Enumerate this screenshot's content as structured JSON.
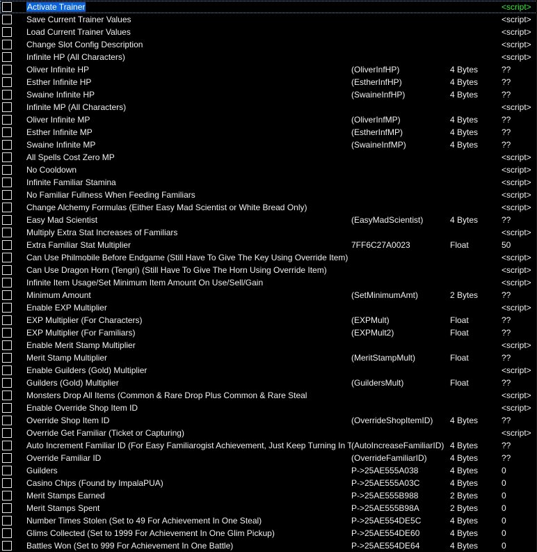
{
  "colors": {
    "background": "#000000",
    "text": "#f0f0f0",
    "selection": "#0a64d8",
    "active_value": "#38e838"
  },
  "entries": [
    {
      "active": false,
      "description": "Activate Trainer",
      "address": "",
      "type": "",
      "value": "<script>"
    },
    {
      "active": false,
      "description": "Save Current Trainer Values",
      "address": "",
      "type": "",
      "value": "<script>"
    },
    {
      "active": false,
      "description": "Load Current Trainer Values",
      "address": "",
      "type": "",
      "value": "<script>"
    },
    {
      "active": false,
      "description": "Change Slot Config Description",
      "address": "",
      "type": "",
      "value": "<script>"
    },
    {
      "active": false,
      "description": "Infinite HP (All Characters)",
      "address": "",
      "type": "",
      "value": "<script>"
    },
    {
      "active": false,
      "description": "Oliver Infinite HP",
      "address": "(OliverInfHP)",
      "type": "4 Bytes",
      "value": "??"
    },
    {
      "active": false,
      "description": "Esther Infinite HP",
      "address": "(EstherInfHP)",
      "type": "4 Bytes",
      "value": "??"
    },
    {
      "active": false,
      "description": "Swaine Infinite HP",
      "address": "(SwaineInfHP)",
      "type": "4 Bytes",
      "value": "??"
    },
    {
      "active": false,
      "description": "Infinite MP (All Characters)",
      "address": "",
      "type": "",
      "value": "<script>"
    },
    {
      "active": false,
      "description": "Oliver Infinite MP",
      "address": "(OliverInfMP)",
      "type": "4 Bytes",
      "value": "??"
    },
    {
      "active": false,
      "description": "Esther Infinite MP",
      "address": "(EstherInfMP)",
      "type": "4 Bytes",
      "value": "??"
    },
    {
      "active": false,
      "description": "Swaine Infinite MP",
      "address": "(SwaineInfMP)",
      "type": "4 Bytes",
      "value": "??"
    },
    {
      "active": false,
      "description": "All Spells Cost Zero MP",
      "address": "",
      "type": "",
      "value": "<script>"
    },
    {
      "active": false,
      "description": "No Cooldown",
      "address": "",
      "type": "",
      "value": "<script>"
    },
    {
      "active": false,
      "description": "Infinite Familiar Stamina",
      "address": "",
      "type": "",
      "value": "<script>"
    },
    {
      "active": false,
      "description": "No Familiar Fullness When Feeding Familiars",
      "address": "",
      "type": "",
      "value": "<script>"
    },
    {
      "active": false,
      "description": "Change Alchemy Formulas (Either Easy Mad Scientist or White Bread Only)",
      "address": "",
      "type": "",
      "value": "<script>"
    },
    {
      "active": false,
      "description": "Easy Mad Scientist",
      "address": "(EasyMadScientist)",
      "type": "4 Bytes",
      "value": "??"
    },
    {
      "active": false,
      "description": "Multiply Extra Stat Increases of Familiars",
      "address": "",
      "type": "",
      "value": "<script>"
    },
    {
      "active": false,
      "description": "Extra Familiar Stat Multiplier",
      "address": "7FF6C27A0023",
      "type": "Float",
      "value": "50"
    },
    {
      "active": false,
      "description": "Can Use Philmobile Before Endgame (Still Have To Give The Key Using Override Item)",
      "address": "",
      "type": "",
      "value": "<script>"
    },
    {
      "active": false,
      "description": "Can Use Dragon Horn (Tengri) (Still Have To Give The Horn Using Override Item)",
      "address": "",
      "type": "",
      "value": "<script>"
    },
    {
      "active": false,
      "description": "Infinite Item Usage/Set Minimum Item Amount On Use/Sell/Gain",
      "address": "",
      "type": "",
      "value": "<script>"
    },
    {
      "active": false,
      "description": "Minimum Amount",
      "address": "(SetMinimumAmt)",
      "type": "2 Bytes",
      "value": "??"
    },
    {
      "active": false,
      "description": "Enable EXP Multiplier",
      "address": "",
      "type": "",
      "value": "<script>"
    },
    {
      "active": false,
      "description": "EXP Multiplier (For Characters)",
      "address": "(EXPMult)",
      "type": "Float",
      "value": "??"
    },
    {
      "active": false,
      "description": "EXP Multiplier (For Familiars)",
      "address": "(EXPMult2)",
      "type": "Float",
      "value": "??"
    },
    {
      "active": false,
      "description": "Enable Merit Stamp Multiplier",
      "address": "",
      "type": "",
      "value": "<script>"
    },
    {
      "active": false,
      "description": "Merit Stamp Multiplier",
      "address": "(MeritStampMult)",
      "type": "Float",
      "value": "??"
    },
    {
      "active": false,
      "description": "Enable Guilders (Gold) Multiplier",
      "address": "",
      "type": "",
      "value": "<script>"
    },
    {
      "active": false,
      "description": "Guilders (Gold) Multiplier",
      "address": "(GuildersMult)",
      "type": "Float",
      "value": "??"
    },
    {
      "active": false,
      "description": "Monsters Drop All Items (Common & Rare Drop Plus Common & Rare Steal",
      "address": "",
      "type": "",
      "value": "<script>"
    },
    {
      "active": false,
      "description": "Enable Override Shop Item ID",
      "address": "",
      "type": "",
      "value": "<script>"
    },
    {
      "active": false,
      "description": "Override Shop Item ID",
      "address": "(OverrideShopItemID)",
      "type": "4 Bytes",
      "value": "??"
    },
    {
      "active": false,
      "description": "Override Get Familiar (Ticket or Capturing)",
      "address": "",
      "type": "",
      "value": "<script>"
    },
    {
      "active": false,
      "description": "Auto Increment Familiar ID (For Easy Familiarogist Achievement, Just Keep Turning In Tic",
      "address": "(AutoIncreaseFamiliarID)",
      "type": "4 Bytes",
      "value": "??"
    },
    {
      "active": false,
      "description": "Override Familiar ID",
      "address": "(OverrideFamiliarID)",
      "type": "4 Bytes",
      "value": "??"
    },
    {
      "active": false,
      "description": "Guilders",
      "address": "P->25AE555A038",
      "type": "4 Bytes",
      "value": "0"
    },
    {
      "active": false,
      "description": "Casino Chips (Found by ImpalaPUA)",
      "address": "P->25AE555A03C",
      "type": "4 Bytes",
      "value": "0"
    },
    {
      "active": false,
      "description": "Merit Stamps Earned",
      "address": "P->25AE555B988",
      "type": "2 Bytes",
      "value": "0"
    },
    {
      "active": false,
      "description": "Merit Stamps Spent",
      "address": "P->25AE555B98A",
      "type": "2 Bytes",
      "value": "0"
    },
    {
      "active": false,
      "description": "Number Times Stolen (Set to 49 For Achievement In One Steal)",
      "address": "P->25AE554DE5C",
      "type": "4 Bytes",
      "value": "0"
    },
    {
      "active": false,
      "description": "Glims Collected (Set to 1999 For Achievement In One Glim Pickup)",
      "address": "P->25AE554DE60",
      "type": "4 Bytes",
      "value": "0"
    },
    {
      "active": false,
      "description": "Battles Won (Set to 999 For Achievement In One Battle)",
      "address": "P->25AE554DE64",
      "type": "4 Bytes",
      "value": "0"
    }
  ]
}
